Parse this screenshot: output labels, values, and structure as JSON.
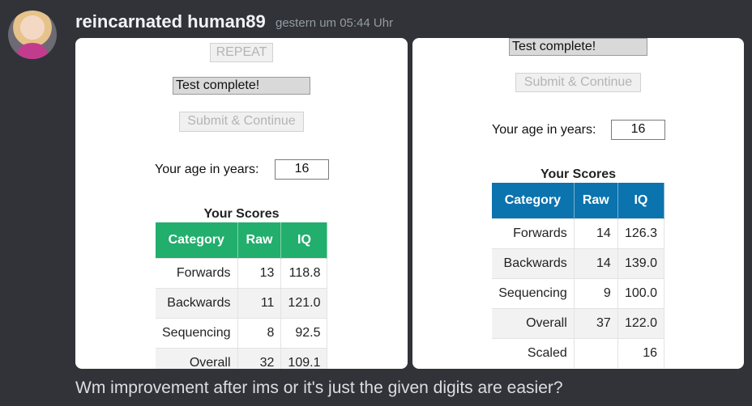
{
  "message": {
    "username": "reincarnated human89",
    "timestamp": "gestern um 05:44 Uhr",
    "text": "Wm improvement after ims or it's just the given digits are easier?"
  },
  "left": {
    "repeat_label": "REPEAT",
    "status": "Test complete!",
    "submit_label": "Submit & Continue",
    "age_label": "Your age in years:",
    "age_value": "16",
    "scores_title": "Your Scores",
    "headers": [
      "Category",
      "Raw",
      "IQ"
    ],
    "rows": [
      [
        "Forwards",
        "13",
        "118.8"
      ],
      [
        "Backwards",
        "11",
        "121.0"
      ],
      [
        "Sequencing",
        "8",
        "92.5"
      ],
      [
        "Overall",
        "32",
        "109.1"
      ]
    ],
    "header_color": "#22ae6c"
  },
  "right": {
    "status": "Test complete!",
    "submit_label": "Submit & Continue",
    "age_label": "Your age in years:",
    "age_value": "16",
    "scores_title": "Your Scores",
    "headers": [
      "Category",
      "Raw",
      "IQ"
    ],
    "rows": [
      [
        "Forwards",
        "14",
        "126.3"
      ],
      [
        "Backwards",
        "14",
        "139.0"
      ],
      [
        "Sequencing",
        "9",
        "100.0"
      ],
      [
        "Overall",
        "37",
        "122.0"
      ],
      [
        "Scaled",
        "",
        "16"
      ]
    ],
    "header_color": "#0b73ad"
  }
}
